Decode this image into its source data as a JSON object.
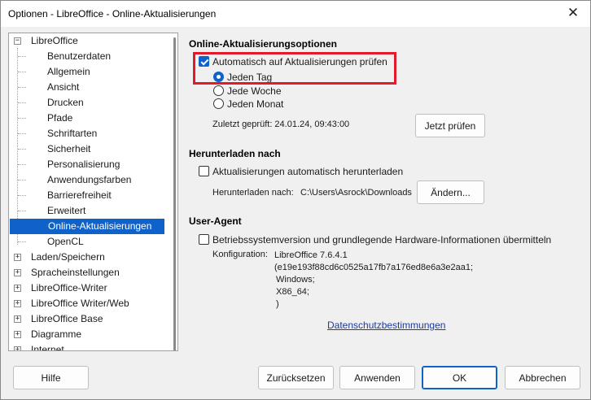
{
  "window": {
    "title": "Optionen - LibreOffice - Online-Aktualisierungen",
    "close_glyph": "✕"
  },
  "tree": {
    "items": [
      {
        "label": "LibreOffice",
        "level": 0,
        "expander": "−"
      },
      {
        "label": "Benutzerdaten",
        "level": 1
      },
      {
        "label": "Allgemein",
        "level": 1
      },
      {
        "label": "Ansicht",
        "level": 1
      },
      {
        "label": "Drucken",
        "level": 1
      },
      {
        "label": "Pfade",
        "level": 1
      },
      {
        "label": "Schriftarten",
        "level": 1
      },
      {
        "label": "Sicherheit",
        "level": 1
      },
      {
        "label": "Personalisierung",
        "level": 1
      },
      {
        "label": "Anwendungsfarben",
        "level": 1
      },
      {
        "label": "Barrierefreiheit",
        "level": 1
      },
      {
        "label": "Erweitert",
        "level": 1
      },
      {
        "label": "Online-Aktualisierungen",
        "level": 1,
        "selected": true
      },
      {
        "label": "OpenCL",
        "level": 1
      },
      {
        "label": "Laden/Speichern",
        "level": 0,
        "expander": "+"
      },
      {
        "label": "Spracheinstellungen",
        "level": 0,
        "expander": "+"
      },
      {
        "label": "LibreOffice-Writer",
        "level": 0,
        "expander": "+"
      },
      {
        "label": "LibreOffice Writer/Web",
        "level": 0,
        "expander": "+"
      },
      {
        "label": "LibreOffice Base",
        "level": 0,
        "expander": "+"
      },
      {
        "label": "Diagramme",
        "level": 0,
        "expander": "+"
      },
      {
        "label": "Internet",
        "level": 0,
        "expander": "+"
      }
    ]
  },
  "online_update": {
    "section_title": "Online-Aktualisierungsoptionen",
    "auto_check_label": "Automatisch auf Aktualisierungen prüfen",
    "auto_check_checked": true,
    "frequency_options": [
      {
        "label": "Jeden Tag",
        "checked": true
      },
      {
        "label": "Jede Woche",
        "checked": false
      },
      {
        "label": "Jeden Monat",
        "checked": false
      }
    ],
    "last_checked": "Zuletzt geprüft: 24.01.24, 09:43:00",
    "check_now_button": "Jetzt prüfen"
  },
  "download": {
    "section_title": "Herunterladen nach",
    "auto_download_label": "Aktualisierungen automatisch herunterladen",
    "auto_download_checked": false,
    "path_label": "Herunterladen nach:",
    "path_value": "C:\\Users\\Asrock\\Downloads",
    "change_button": "Ändern..."
  },
  "user_agent": {
    "section_title": "User-Agent",
    "send_info_label": "Betriebssystemversion und grundlegende Hardware-Informationen übermitteln",
    "send_info_checked": false,
    "config_label": "Konfiguration:",
    "config_lines": [
      "LibreOffice 7.6.4.1",
      "(e19e193f88cd6c0525a17fb7a176ed8e6a3e2aa1;",
      "Windows;",
      "X86_64;",
      ")"
    ],
    "privacy_link": "Datenschutzbestimmungen"
  },
  "footer": {
    "help_button": "Hilfe",
    "reset_button": "Zurücksetzen",
    "apply_button": "Anwenden",
    "ok_button": "OK",
    "cancel_button": "Abbrechen"
  },
  "colors": {
    "accent": "#0f62c9",
    "highlight_frame": "#e21b2c",
    "link": "#1c3b9b"
  }
}
